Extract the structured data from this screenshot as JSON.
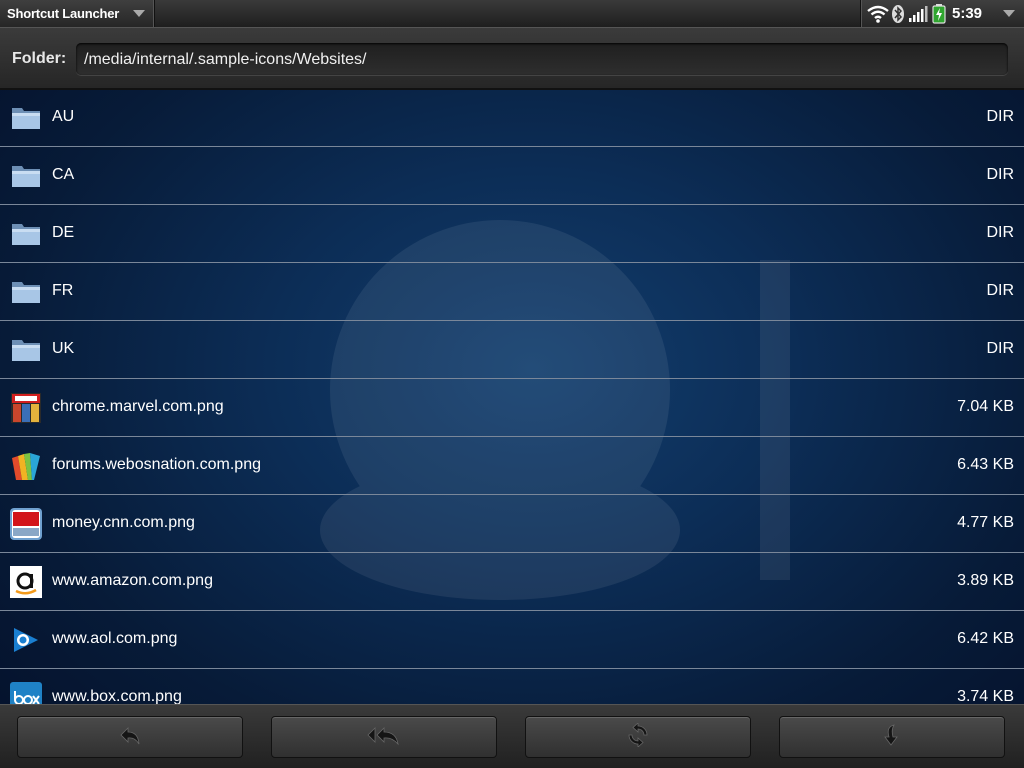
{
  "statusbar": {
    "app_title": "Shortcut Launcher",
    "time": "5:39",
    "icons": [
      "wifi-icon",
      "bluetooth-icon",
      "signal-icon",
      "battery-icon"
    ]
  },
  "folder": {
    "label": "Folder:",
    "path": "/media/internal/.sample-icons/Websites/"
  },
  "files": [
    {
      "name": "AU",
      "size": "DIR",
      "icon": "folder-icon"
    },
    {
      "name": "CA",
      "size": "DIR",
      "icon": "folder-icon"
    },
    {
      "name": "DE",
      "size": "DIR",
      "icon": "folder-icon"
    },
    {
      "name": "FR",
      "size": "DIR",
      "icon": "folder-icon"
    },
    {
      "name": "UK",
      "size": "DIR",
      "icon": "folder-icon"
    },
    {
      "name": "chrome.marvel.com.png",
      "size": "7.04 KB",
      "icon": "marvel-icon"
    },
    {
      "name": "forums.webosnation.com.png",
      "size": "6.43 KB",
      "icon": "webosnation-icon"
    },
    {
      "name": "money.cnn.com.png",
      "size": "4.77 KB",
      "icon": "cnn-money-icon"
    },
    {
      "name": "www.amazon.com.png",
      "size": "3.89 KB",
      "icon": "amazon-icon"
    },
    {
      "name": "www.aol.com.png",
      "size": "6.42 KB",
      "icon": "aol-icon"
    },
    {
      "name": "www.box.com.png",
      "size": "3.74 KB",
      "icon": "box-icon"
    }
  ],
  "toolbar": {
    "buttons": [
      "back-icon",
      "back-all-icon",
      "refresh-icon",
      "select-down-icon"
    ]
  },
  "colors": {
    "background": "#0c2d56",
    "row_divider": "#7a8799",
    "text": "#ffffff"
  }
}
